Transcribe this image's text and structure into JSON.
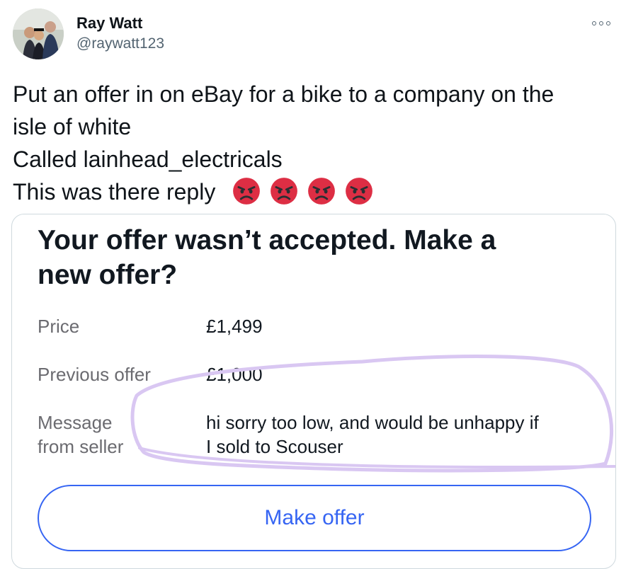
{
  "author": {
    "name": "Ray Watt",
    "handle": "@raywatt123",
    "avatar_icon": "family-photo-avatar"
  },
  "more_icon": "more-options-icon",
  "tweet": {
    "lines": [
      "Put an offer in on eBay for a bike to a company on the",
      "isle of white",
      "Called lainhead_electricals",
      "This was there reply"
    ],
    "emoji": [
      "angry-face",
      "angry-face",
      "angry-face",
      "angry-face"
    ]
  },
  "card": {
    "title_line1": "Your offer wasn’t accepted. Make a",
    "title_line2": "new offer?",
    "price_label": "Price",
    "price_value": "£1,499",
    "previous_offer_label": "Previous offer",
    "previous_offer_value": "£1,000",
    "message_label_line1": "Message",
    "message_label_line2": "from seller",
    "message_line1": "hi sorry too low, and would be unhappy if",
    "message_line2": "I sold to Scouser",
    "make_offer_label": "Make offer",
    "highlight_color": "#d9c7f2"
  },
  "colors": {
    "text": "#0f1419",
    "secondary": "#536471",
    "ebay_blue": "#3665f3",
    "angry_red": "#dd2e44"
  }
}
